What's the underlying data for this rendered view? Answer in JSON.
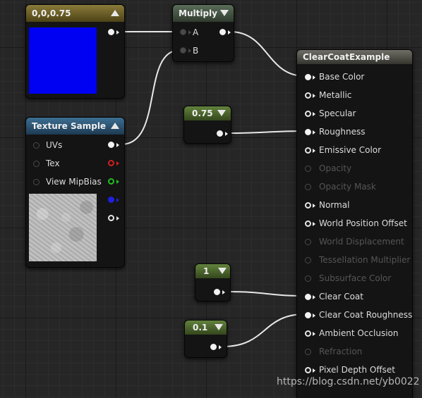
{
  "nodes": {
    "const3": {
      "title": "0,0,0.75",
      "color_value": "#0000f2",
      "output_pin_color": "#f2f2f2"
    },
    "multiply": {
      "title": "Multiply",
      "inputs": [
        "A",
        "B"
      ]
    },
    "texture_sample": {
      "title": "Texture Sample",
      "inputs": [
        "UVs",
        "Tex",
        "View MipBias"
      ],
      "output_pin_colors": [
        "#f2f2f2",
        "#d42020",
        "#20c020",
        "#2020e0",
        "#e6e6e6"
      ]
    },
    "const_roughness": {
      "title": "0.75"
    },
    "const_clearcoat": {
      "title": "1"
    },
    "const_clearcoat_roughness": {
      "title": "0.1"
    },
    "result": {
      "title": "ClearCoatExample",
      "pins": [
        {
          "label": "Base Color",
          "enabled": true,
          "connected": true
        },
        {
          "label": "Metallic",
          "enabled": true,
          "connected": false
        },
        {
          "label": "Specular",
          "enabled": true,
          "connected": false
        },
        {
          "label": "Roughness",
          "enabled": true,
          "connected": true
        },
        {
          "label": "Emissive Color",
          "enabled": true,
          "connected": false
        },
        {
          "label": "Opacity",
          "enabled": false,
          "connected": false
        },
        {
          "label": "Opacity Mask",
          "enabled": false,
          "connected": false
        },
        {
          "label": "Normal",
          "enabled": true,
          "connected": false
        },
        {
          "label": "World Position Offset",
          "enabled": true,
          "connected": false
        },
        {
          "label": "World Displacement",
          "enabled": false,
          "connected": false
        },
        {
          "label": "Tessellation Multiplier",
          "enabled": false,
          "connected": false
        },
        {
          "label": "Subsurface Color",
          "enabled": false,
          "connected": false
        },
        {
          "label": "Clear Coat",
          "enabled": true,
          "connected": true
        },
        {
          "label": "Clear Coat Roughness",
          "enabled": true,
          "connected": true
        },
        {
          "label": "Ambient Occlusion",
          "enabled": true,
          "connected": false
        },
        {
          "label": "Refraction",
          "enabled": false,
          "connected": false
        },
        {
          "label": "Pixel Depth Offset",
          "enabled": true,
          "connected": false
        }
      ]
    }
  },
  "watermark": "https://blog.csdn.net/yb0022",
  "icons": {
    "collapse": "triangle-up-icon",
    "expand": "triangle-down-icon"
  }
}
